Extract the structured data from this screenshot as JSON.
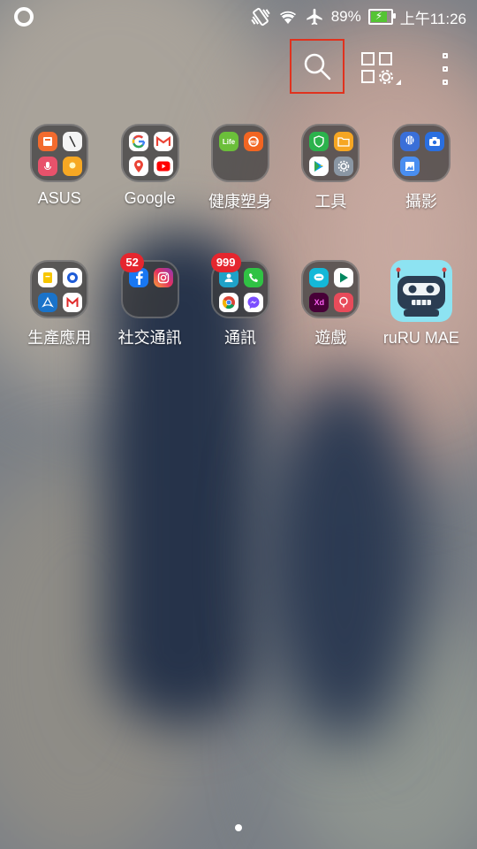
{
  "status_bar": {
    "battery_percent": "89%",
    "battery_level": 0.89,
    "time": "上午11:26",
    "icons": [
      "record-icon",
      "vibrate-icon",
      "wifi-icon",
      "airplane-icon",
      "battery-icon"
    ]
  },
  "toolbar": {
    "icons": [
      "search-icon",
      "grid-settings-icon",
      "more-menu-icon"
    ],
    "highlight_color": "#e0321e"
  },
  "apps": {
    "asus": {
      "label": "ASUS"
    },
    "google": {
      "label": "Google"
    },
    "health": {
      "label": "健康塑身",
      "mini_text": [
        "Life"
      ]
    },
    "tools": {
      "label": "工具"
    },
    "photo": {
      "label": "攝影"
    },
    "productivity": {
      "label": "生產應用"
    },
    "social": {
      "label": "社交通訊",
      "badge": "52"
    },
    "comm": {
      "label": "通訊",
      "badge": "999"
    },
    "games": {
      "label": "遊戲",
      "mini_text": [
        "Xd"
      ]
    },
    "ruru": {
      "label": "ruRU MAE"
    }
  },
  "colors": {
    "badge": "#e5262e",
    "battery_fill": "#55c434"
  },
  "pager": {
    "pages": 1,
    "current": 1
  }
}
